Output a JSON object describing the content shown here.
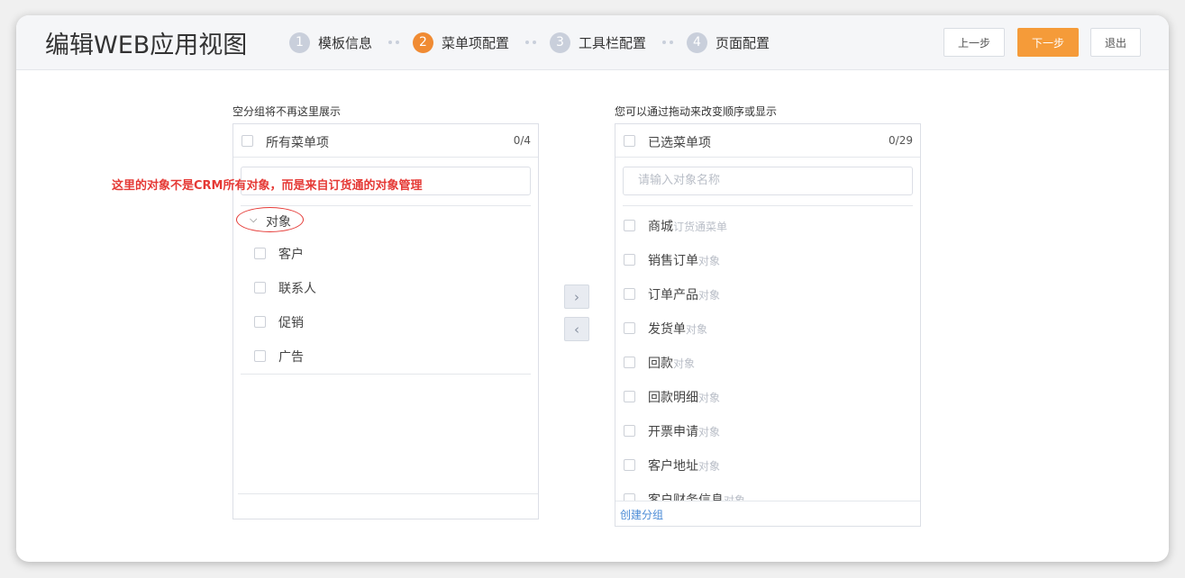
{
  "app": {
    "title": "编辑WEB应用视图"
  },
  "steps": [
    {
      "num": "1",
      "label": "模板信息",
      "active": false
    },
    {
      "num": "2",
      "label": "菜单项配置",
      "active": true
    },
    {
      "num": "3",
      "label": "工具栏配置",
      "active": false
    },
    {
      "num": "4",
      "label": "页面配置",
      "active": false
    }
  ],
  "header_buttons": {
    "prev": "上一步",
    "next": "下一步",
    "exit": "退出"
  },
  "left_panel": {
    "caption": "空分组将不再这里展示",
    "title": "所有菜单项",
    "count": "0/4",
    "group_label": "对象",
    "items": [
      "客户",
      "联系人",
      "促销",
      "广告"
    ]
  },
  "right_panel": {
    "caption": "您可以通过拖动来改变顺序或显示",
    "title": "已选菜单项",
    "count": "0/29",
    "search_placeholder": "请输入对象名称",
    "items": [
      {
        "name": "商城",
        "tag": "订货通菜单"
      },
      {
        "name": "销售订单",
        "tag": "对象"
      },
      {
        "name": "订单产品",
        "tag": "对象"
      },
      {
        "name": "发货单",
        "tag": "对象"
      },
      {
        "name": "回款",
        "tag": "对象"
      },
      {
        "name": "回款明细",
        "tag": "对象"
      },
      {
        "name": "开票申请",
        "tag": "对象"
      },
      {
        "name": "客户地址",
        "tag": "对象"
      },
      {
        "name": "客户财务信息",
        "tag": "对象"
      }
    ],
    "create_group": "创建分组"
  },
  "transfer": {
    "move_right_icon": "chevron-right-icon",
    "move_left_icon": "chevron-left-icon"
  },
  "annotation": "这里的对象不是CRM所有对象，而是来自订货通的对象管理",
  "colors": {
    "accent": "#f59b39",
    "step_active": "#f08b33",
    "annotation": "#e53935",
    "link": "#4a8bd6"
  }
}
